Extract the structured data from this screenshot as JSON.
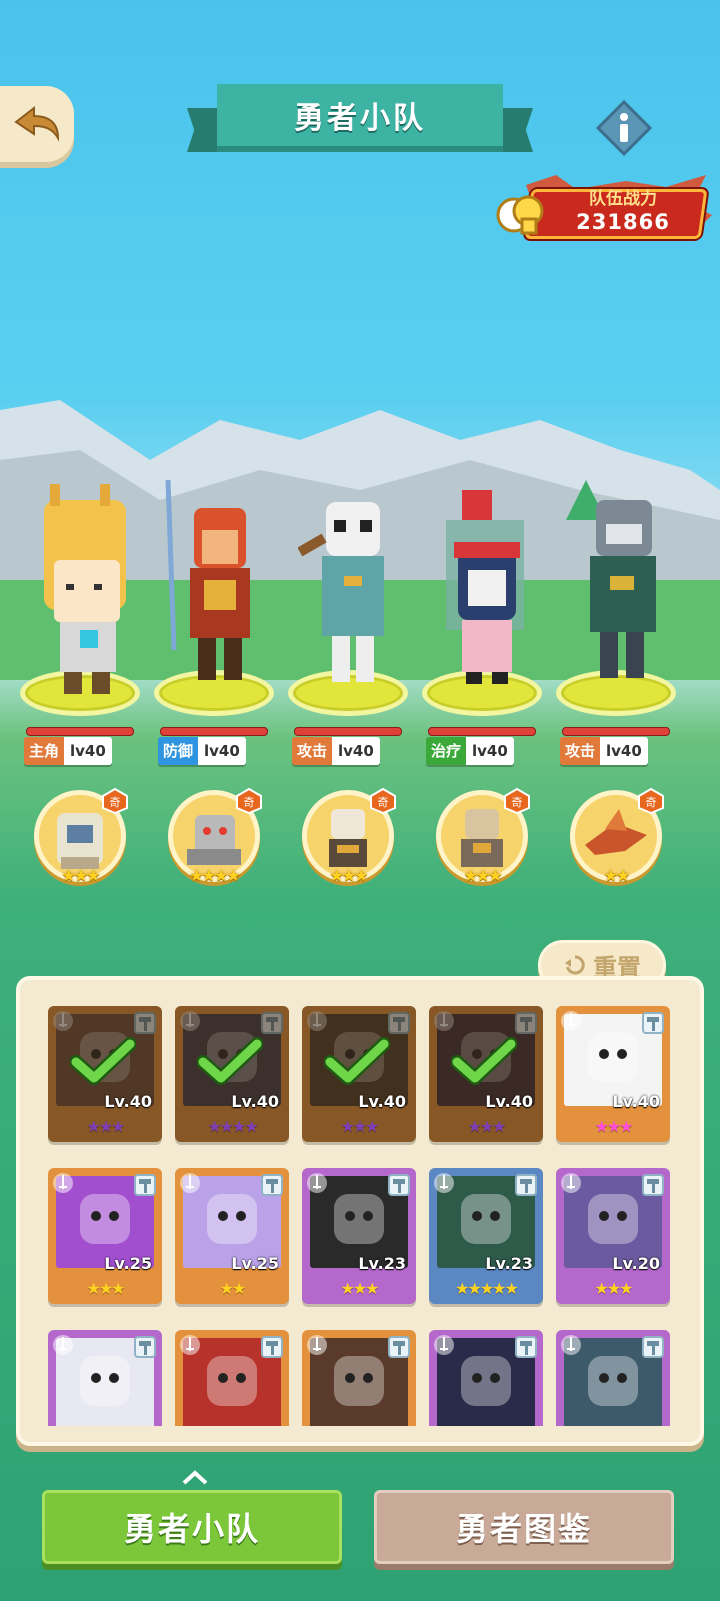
{
  "header": {
    "title": "勇者小队"
  },
  "power": {
    "label": "队伍战力",
    "value": "231866"
  },
  "heroes": [
    {
      "role": "主角",
      "level": "lv40",
      "role_color": "#e0793a",
      "pet_stars": "★★★"
    },
    {
      "role": "防御",
      "level": "lv40",
      "role_color": "#2f95e0",
      "pet_stars": "★★★★"
    },
    {
      "role": "攻击",
      "level": "lv40",
      "role_color": "#e0793a",
      "pet_stars": "★★★"
    },
    {
      "role": "治疗",
      "level": "lv40",
      "role_color": "#3aa93a",
      "pet_stars": "★★★"
    },
    {
      "role": "攻击",
      "level": "lv40",
      "role_color": "#e0793a",
      "pet_stars": "★★"
    }
  ],
  "reset_label": "重置",
  "cards": [
    {
      "level": "Lv.40",
      "stars": "★★★",
      "selected": true
    },
    {
      "level": "Lv.40",
      "stars": "★★★★",
      "selected": true
    },
    {
      "level": "Lv.40",
      "stars": "★★★",
      "selected": true
    },
    {
      "level": "Lv.40",
      "stars": "★★★",
      "selected": true
    },
    {
      "level": "Lv.40",
      "stars": "★★★",
      "selected": false
    },
    {
      "level": "Lv.25",
      "stars": "★★★",
      "selected": false
    },
    {
      "level": "Lv.25",
      "stars": "★★",
      "selected": false
    },
    {
      "level": "Lv.23",
      "stars": "★★★",
      "selected": false
    },
    {
      "level": "Lv.23",
      "stars": "★★★★★",
      "selected": false
    },
    {
      "level": "Lv.20",
      "stars": "★★★",
      "selected": false
    },
    {
      "level": "",
      "stars": "",
      "selected": false
    },
    {
      "level": "",
      "stars": "",
      "selected": false
    },
    {
      "level": "",
      "stars": "",
      "selected": false
    },
    {
      "level": "",
      "stars": "",
      "selected": false
    },
    {
      "level": "",
      "stars": "",
      "selected": false
    }
  ],
  "tabs": {
    "team": "勇者小队",
    "dex": "勇者图鉴"
  },
  "colors": {
    "accent_teal": "#3db3a3",
    "tab_green": "#7cc63a",
    "tab_tan": "#c9aa98",
    "power_red": "#c92a1d"
  }
}
